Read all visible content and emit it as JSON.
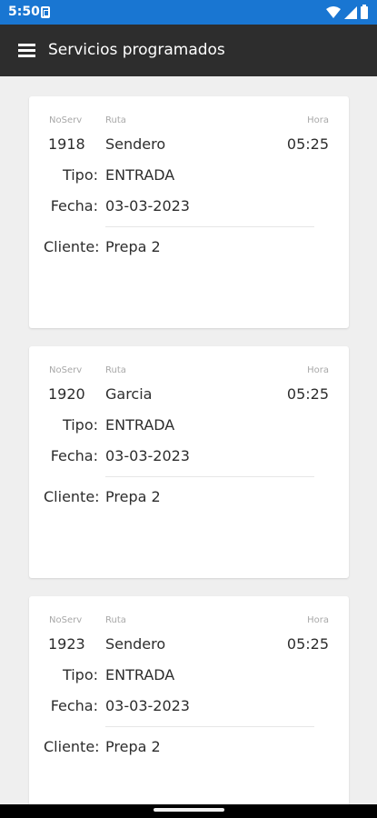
{
  "status_bar": {
    "time": "5:50"
  },
  "app_bar": {
    "title": "Servicios programados",
    "menu_icon": "hamburger-menu-icon"
  },
  "labels": {
    "noserv": "NoServ",
    "ruta": "Ruta",
    "hora": "Hora",
    "tipo": "Tipo:",
    "fecha": "Fecha:",
    "cliente": "Cliente:"
  },
  "services": [
    {
      "noserv": "1918",
      "ruta": "Sendero",
      "hora": "05:25",
      "tipo": "ENTRADA",
      "fecha": "03-03-2023",
      "cliente": "Prepa 2"
    },
    {
      "noserv": "1920",
      "ruta": "Garcia",
      "hora": "05:25",
      "tipo": "ENTRADA",
      "fecha": "03-03-2023",
      "cliente": "Prepa 2"
    },
    {
      "noserv": "1923",
      "ruta": "Sendero",
      "hora": "05:25",
      "tipo": "ENTRADA",
      "fecha": "03-03-2023",
      "cliente": "Prepa 2"
    }
  ]
}
